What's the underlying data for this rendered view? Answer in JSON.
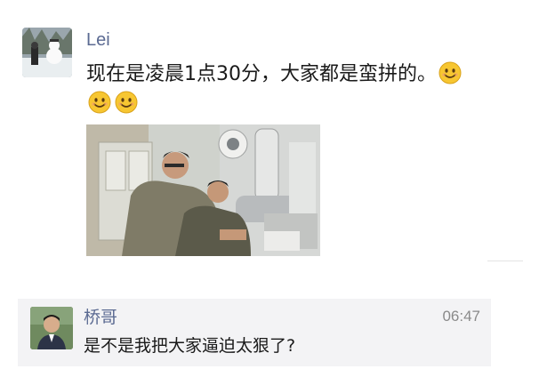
{
  "moment": {
    "author": "Lei",
    "text": "现在是凌晨1点30分，大家都是蛮拼的。",
    "trailing_emojis": [
      "smile-emoji",
      "smile-emoji",
      "smile-emoji"
    ]
  },
  "comment": {
    "author": "桥哥",
    "time": "06:47",
    "text": "是不是我把大家逼迫太狠了?"
  },
  "colors": {
    "name_link": "#5b6a92",
    "comment_bg": "#f3f3f5",
    "emoji_face": "#f7c631"
  }
}
